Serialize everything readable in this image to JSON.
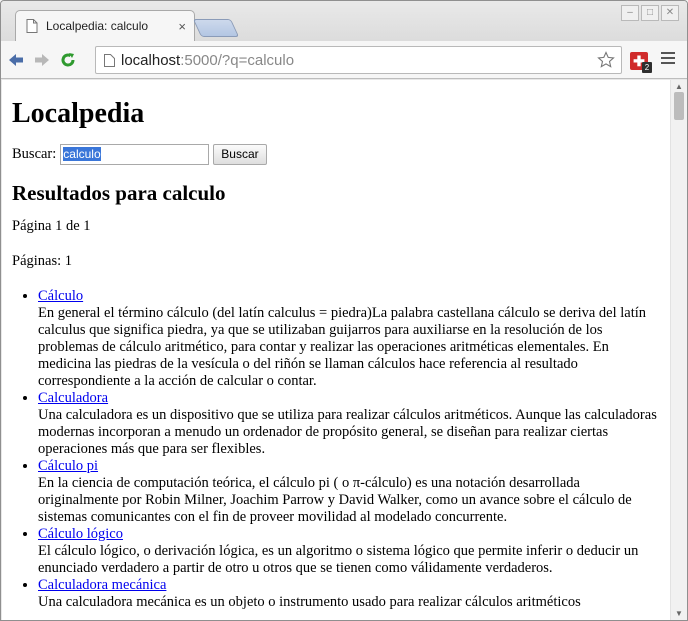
{
  "browser": {
    "tab_title": "Localpedia: calculo",
    "tab_close": "×",
    "url_host": "localhost",
    "url_path": ":5000/?q=calculo",
    "extension_badge": "2"
  },
  "page": {
    "site_title": "Localpedia",
    "search_label": "Buscar:",
    "search_value": "calculo",
    "search_button": "Buscar",
    "results_heading": "Resultados para calculo",
    "pagination_text": "Página 1 de 1",
    "pages_text": "Páginas: 1",
    "results": [
      {
        "title": "Cálculo",
        "snippet": "En general el término cálculo (del latín calculus = piedra)La palabra castellana cálculo se deriva del latín calculus que significa piedra, ya que se utilizaban guijarros para auxiliarse en la resolución de los problemas de cálculo aritmético, para contar y realizar las operaciones aritméticas elementales. En medicina las piedras de la vesícula o del riñón se llaman cálculos hace referencia al resultado correspondiente a la acción de calcular o contar."
      },
      {
        "title": "Calculadora",
        "snippet": "Una calculadora es un dispositivo que se utiliza para realizar cálculos aritméticos. Aunque las calculadoras modernas incorporan a menudo un ordenador de propósito general, se diseñan para realizar ciertas operaciones más que para ser flexibles."
      },
      {
        "title": "Cálculo pi",
        "snippet": "En la ciencia de computación teórica, el cálculo pi ( o π-cálculo) es una notación desarrollada originalmente por Robin Milner, Joachim Parrow y David Walker, como un avance sobre el cálculo de sistemas comunicantes con el fin de proveer movilidad al modelado concurrente."
      },
      {
        "title": "Cálculo lógico",
        "snippet": "El cálculo lógico, o derivación lógica, es un algoritmo o sistema lógico que permite inferir o deducir un enunciado verdadero a partir de otro u otros que se tienen como válidamente verdaderos."
      },
      {
        "title": "Calculadora mecánica",
        "snippet": "Una calculadora mecánica es un objeto o instrumento usado para realizar cálculos aritméticos"
      }
    ]
  },
  "colors": {
    "link": "#0000ee",
    "selection": "#3a76d9"
  }
}
